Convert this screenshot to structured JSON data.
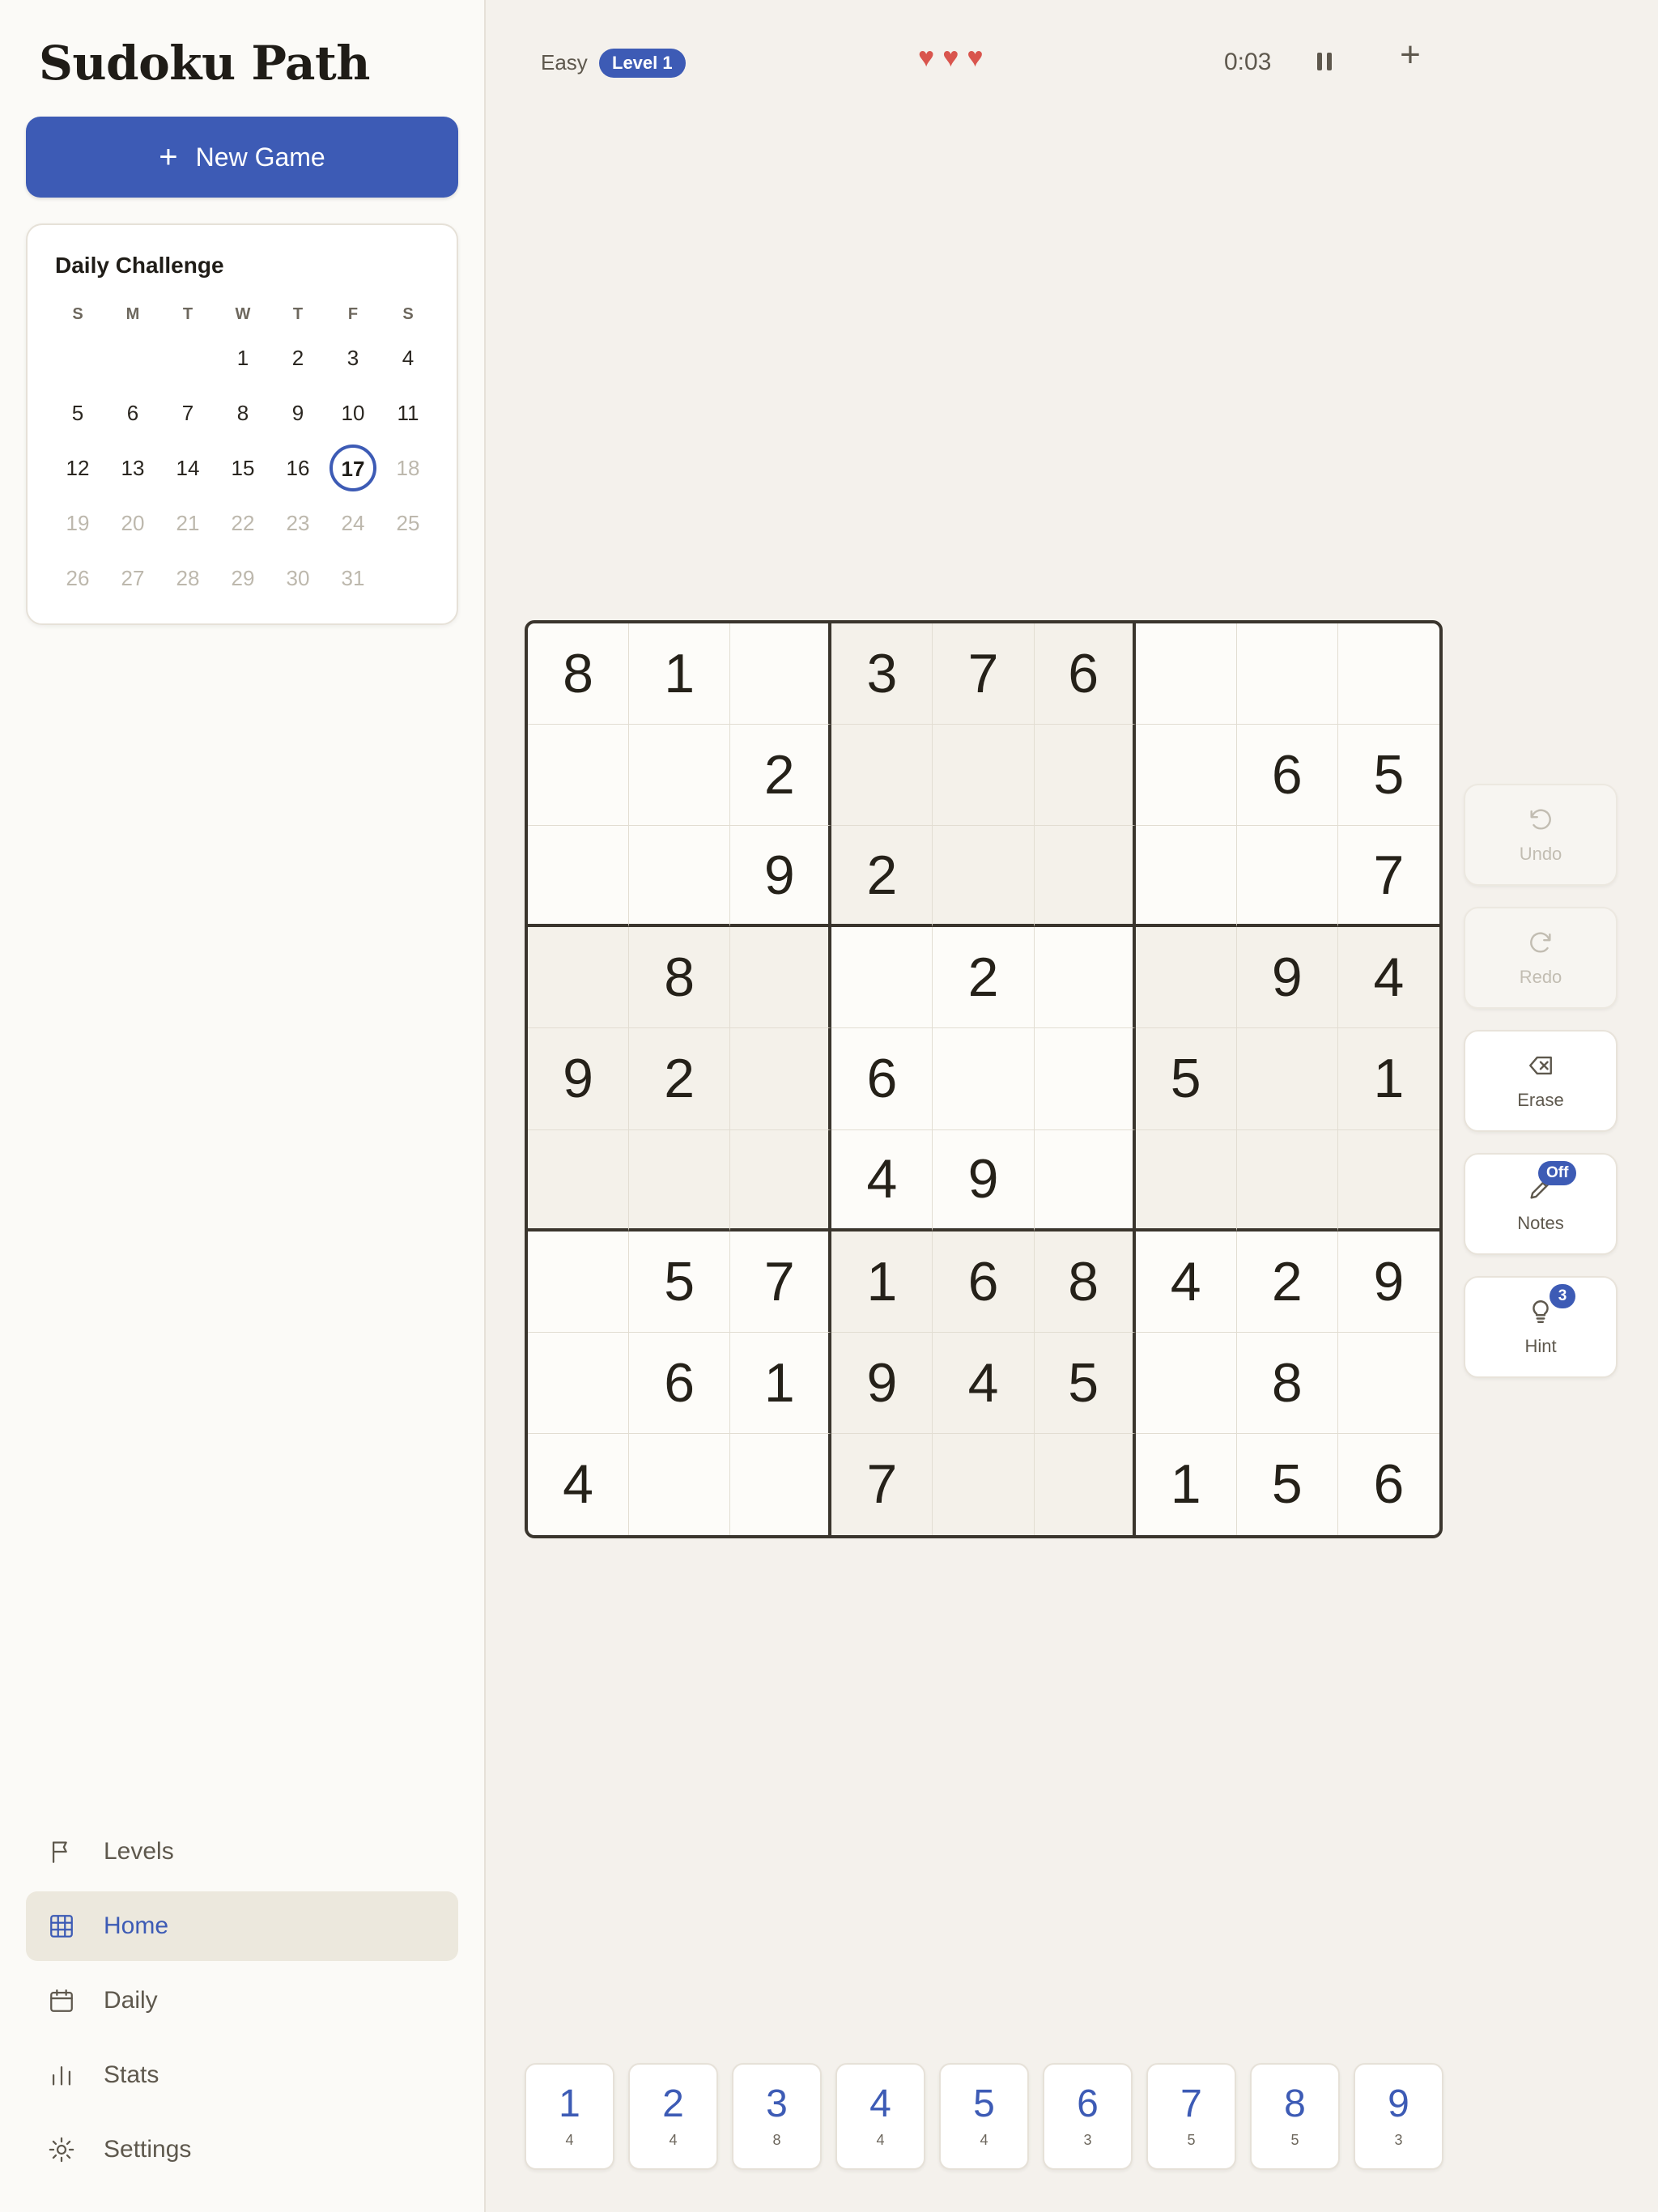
{
  "app": {
    "title": "Sudoku Path"
  },
  "sidebar": {
    "new_game_label": "New Game",
    "calendar": {
      "title": "Daily Challenge",
      "weekdays": [
        "S",
        "M",
        "T",
        "W",
        "T",
        "F",
        "S"
      ],
      "weeks": [
        [
          "",
          "",
          "",
          "1",
          "2",
          "3",
          "4"
        ],
        [
          "5",
          "6",
          "7",
          "8",
          "9",
          "10",
          "11"
        ],
        [
          "12",
          "13",
          "14",
          "15",
          "16",
          "17",
          "18"
        ],
        [
          "19",
          "20",
          "21",
          "22",
          "23",
          "24",
          "25"
        ],
        [
          "26",
          "27",
          "28",
          "29",
          "30",
          "31",
          ""
        ]
      ],
      "today": "17"
    },
    "nav": [
      {
        "label": "Levels",
        "icon": "flag-icon",
        "active": false
      },
      {
        "label": "Home",
        "icon": "grid-icon",
        "active": true
      },
      {
        "label": "Daily",
        "icon": "calendar-icon",
        "active": false
      },
      {
        "label": "Stats",
        "icon": "bar-chart-icon",
        "active": false
      },
      {
        "label": "Settings",
        "icon": "sun-gear-icon",
        "active": false
      }
    ]
  },
  "header": {
    "difficulty": "Easy",
    "level": "Level 1",
    "lives": 3,
    "timer": "0:03"
  },
  "board": {
    "rows": [
      [
        "8",
        "1",
        "",
        "3",
        "7",
        "6",
        "",
        "",
        ""
      ],
      [
        "",
        "",
        "2",
        "",
        "",
        "",
        "",
        "6",
        "5"
      ],
      [
        "",
        "",
        "9",
        "2",
        "",
        "",
        "",
        "",
        "7"
      ],
      [
        "",
        "8",
        "",
        "",
        "2",
        "",
        "",
        "9",
        "4"
      ],
      [
        "9",
        "2",
        "",
        "6",
        "",
        "",
        "5",
        "",
        "1"
      ],
      [
        "",
        "",
        "",
        "4",
        "9",
        "",
        "",
        "",
        ""
      ],
      [
        "",
        "5",
        "7",
        "1",
        "6",
        "8",
        "4",
        "2",
        "9"
      ],
      [
        "",
        "6",
        "1",
        "9",
        "4",
        "5",
        "",
        "8",
        ""
      ],
      [
        "4",
        "",
        "",
        "7",
        "",
        "",
        "1",
        "5",
        "6"
      ]
    ]
  },
  "tools": {
    "undo": {
      "label": "Undo",
      "enabled": false
    },
    "redo": {
      "label": "Redo",
      "enabled": false
    },
    "erase": {
      "label": "Erase",
      "enabled": true
    },
    "notes": {
      "label": "Notes",
      "badge": "Off"
    },
    "hint": {
      "label": "Hint",
      "badge": "3"
    }
  },
  "numpad": [
    {
      "digit": "1",
      "remaining": "4"
    },
    {
      "digit": "2",
      "remaining": "4"
    },
    {
      "digit": "3",
      "remaining": "8"
    },
    {
      "digit": "4",
      "remaining": "4"
    },
    {
      "digit": "5",
      "remaining": "4"
    },
    {
      "digit": "6",
      "remaining": "3"
    },
    {
      "digit": "7",
      "remaining": "5"
    },
    {
      "digit": "8",
      "remaining": "5"
    },
    {
      "digit": "9",
      "remaining": "3"
    }
  ],
  "colors": {
    "accent": "#3d5bb5",
    "heart": "#d9554d",
    "board_border": "#3a352d"
  }
}
